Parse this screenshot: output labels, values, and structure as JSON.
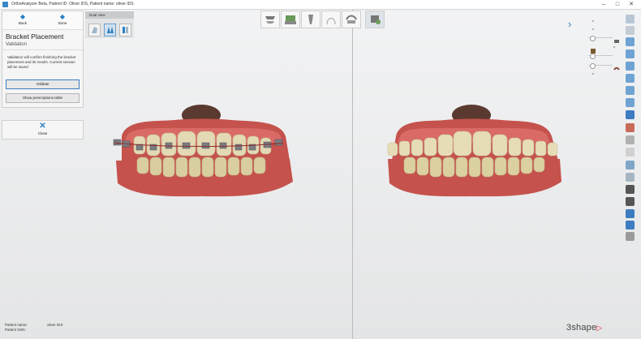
{
  "window": {
    "title": "OrthoAnalyzer Beta, Patient ID: Oliver IDS, Patient name: oliver IDS",
    "controls": [
      "–",
      "□",
      "✕"
    ]
  },
  "nav": {
    "back_label": "Back",
    "done_label": "Done"
  },
  "step": {
    "title": "Bracket Placement",
    "subtitle": "Validation",
    "description": "Validation will confirm finishing the bracket placement and its results. Current session will be saved",
    "validate_label": "Validate",
    "prescriptions_label": "Show prescriptions table"
  },
  "close": {
    "label": "Close"
  },
  "dual_view": {
    "title": "Dual view",
    "selected_index": 1
  },
  "toolbar": {
    "items": [
      "upper-jaw-icon",
      "models-icon",
      "tooth-icon",
      "arch-icon",
      "brackets-icon",
      "bracket-tooth-icon"
    ],
    "selected_index": 5
  },
  "right_tools": {
    "icons": [
      "rotate-icon",
      "view-front-icon",
      "view-back-icon",
      "view-left-icon",
      "view-right-icon",
      "view-top-icon",
      "view-bottom-icon",
      "view-iso-icon",
      "tooth-color-icon",
      "measure-icon",
      "occlusion-icon",
      "cross-section-icon",
      "zoom-icon",
      "screenshot-icon",
      "undo-icon",
      "redo-icon",
      "settings-icon"
    ]
  },
  "footer": {
    "patient_name_label": "Patient name:",
    "patient_name_value": "oliver IDS",
    "patient_ssn_label": "Patient SSN:"
  },
  "brand": {
    "logo_text": "3shape"
  },
  "colors": {
    "accent": "#2b7fc1",
    "gum": "#c0504c",
    "teeth": "#e6ddb8",
    "logo_red": "#d9232e"
  }
}
